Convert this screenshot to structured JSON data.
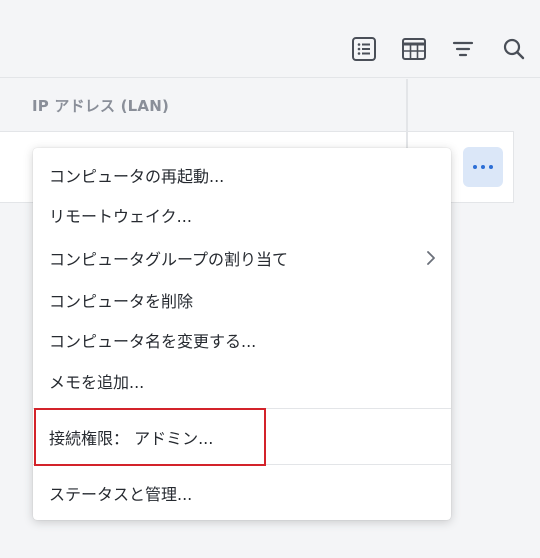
{
  "toolbar": {
    "icons": [
      "list-view-icon",
      "table-view-icon",
      "filter-icon",
      "search-icon"
    ]
  },
  "table": {
    "column_header": "IP アドレス (LAN)"
  },
  "row_actions": {
    "more_icon": "more-horizontal-icon"
  },
  "context_menu": {
    "items": [
      "コンピュータの再起動...",
      "リモートウェイク...",
      "コンピュータグループの割り当て",
      "コンピュータを削除",
      "コンピュータ名を変更する...",
      "メモを追加...",
      "接続権限： アドミン...",
      "ステータスと管理..."
    ]
  },
  "colors": {
    "accent": "#2d6fd6",
    "highlight": "#d3232a"
  }
}
